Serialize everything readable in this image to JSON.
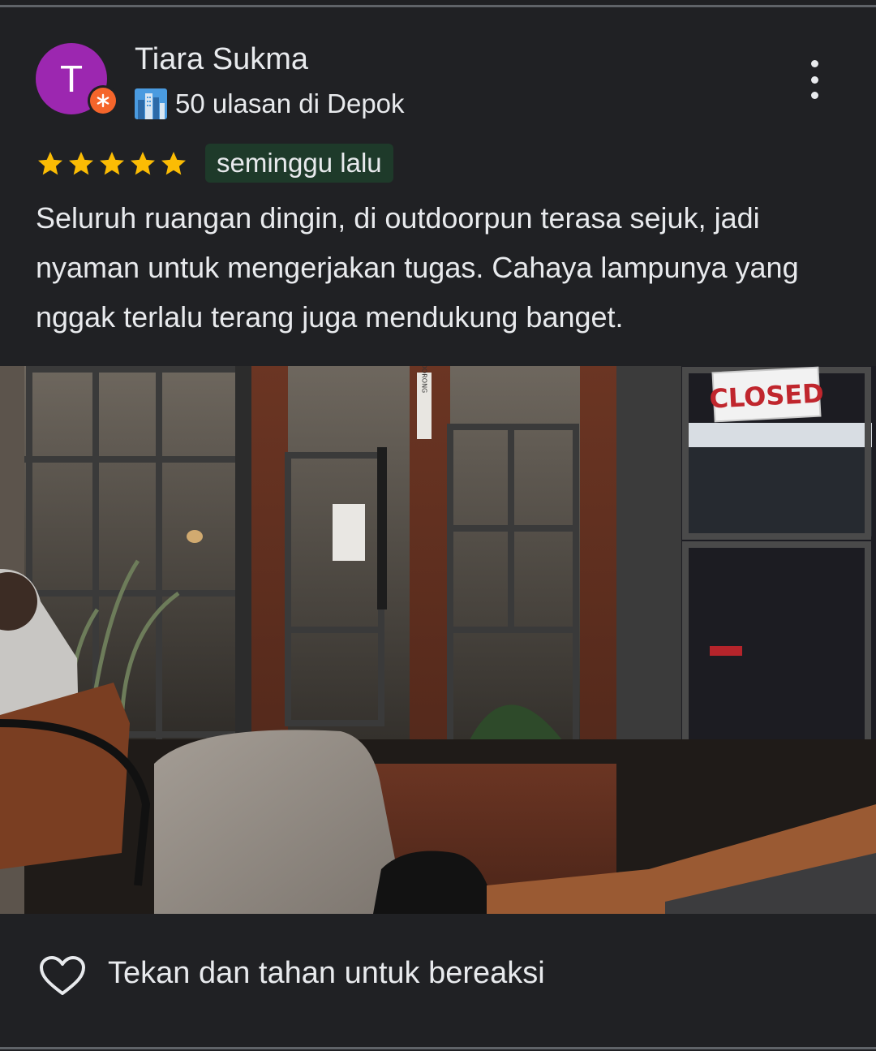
{
  "review": {
    "author_initial": "T",
    "author_name": "Tiara Sukma",
    "author_meta": "50 ulasan di Depok",
    "rating": 5,
    "date": "seminggu lalu",
    "text": "Seluruh ruangan dingin, di outdoorpun terasa sejuk, jadi nyaman untuk mengerjakan tugas. Cahaya lampunya yang nggak terlalu terang juga mendukung banget."
  },
  "photo": {
    "door_sticker": "DORONG",
    "closed_sign": "CLOSED"
  },
  "reaction": {
    "label": "Tekan dan tahan untuk bereaksi"
  },
  "colors": {
    "background": "#202124",
    "avatar": "#9c27b0",
    "local_guide_badge": "#f5652b",
    "star": "#fbbc04",
    "date_badge": "#1e3a2a"
  },
  "icons": {
    "more": "more-vert-icon",
    "city": "city-icon",
    "heart": "heart-outline-icon"
  }
}
